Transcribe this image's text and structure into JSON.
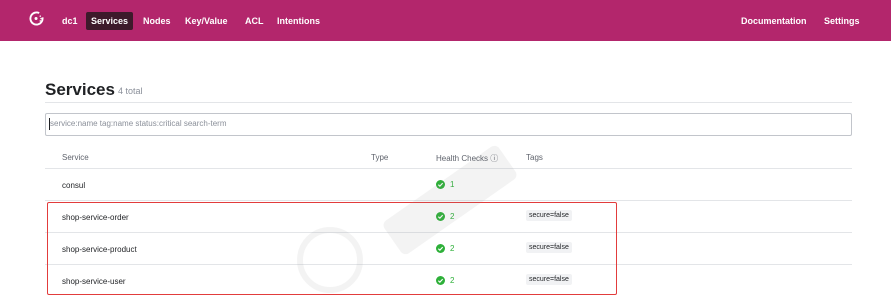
{
  "nav": {
    "datacenter": "dc1",
    "items": [
      "Services",
      "Nodes",
      "Key/Value",
      "ACL",
      "Intentions"
    ],
    "right": [
      "Documentation",
      "Settings"
    ]
  },
  "header": {
    "title": "Services",
    "count": "4 total"
  },
  "search": {
    "placeholder": "service:name tag:name status:critical search-term"
  },
  "table": {
    "columns": [
      "Service",
      "Type",
      "Health Checks ⓘ",
      "Tags"
    ],
    "rows": [
      {
        "name": "consul",
        "checks": "1",
        "tag": ""
      },
      {
        "name": "shop-service-order",
        "checks": "2",
        "tag": "secure=false"
      },
      {
        "name": "shop-service-product",
        "checks": "2",
        "tag": "secure=false"
      },
      {
        "name": "shop-service-user",
        "checks": "2",
        "tag": "secure=false"
      }
    ]
  },
  "colors": {
    "nav_bg": "#b3266c",
    "passing": "#2eb039",
    "highlight": "#e23c3c"
  },
  "icons": [
    "consul-logo-icon",
    "check-icon"
  ]
}
